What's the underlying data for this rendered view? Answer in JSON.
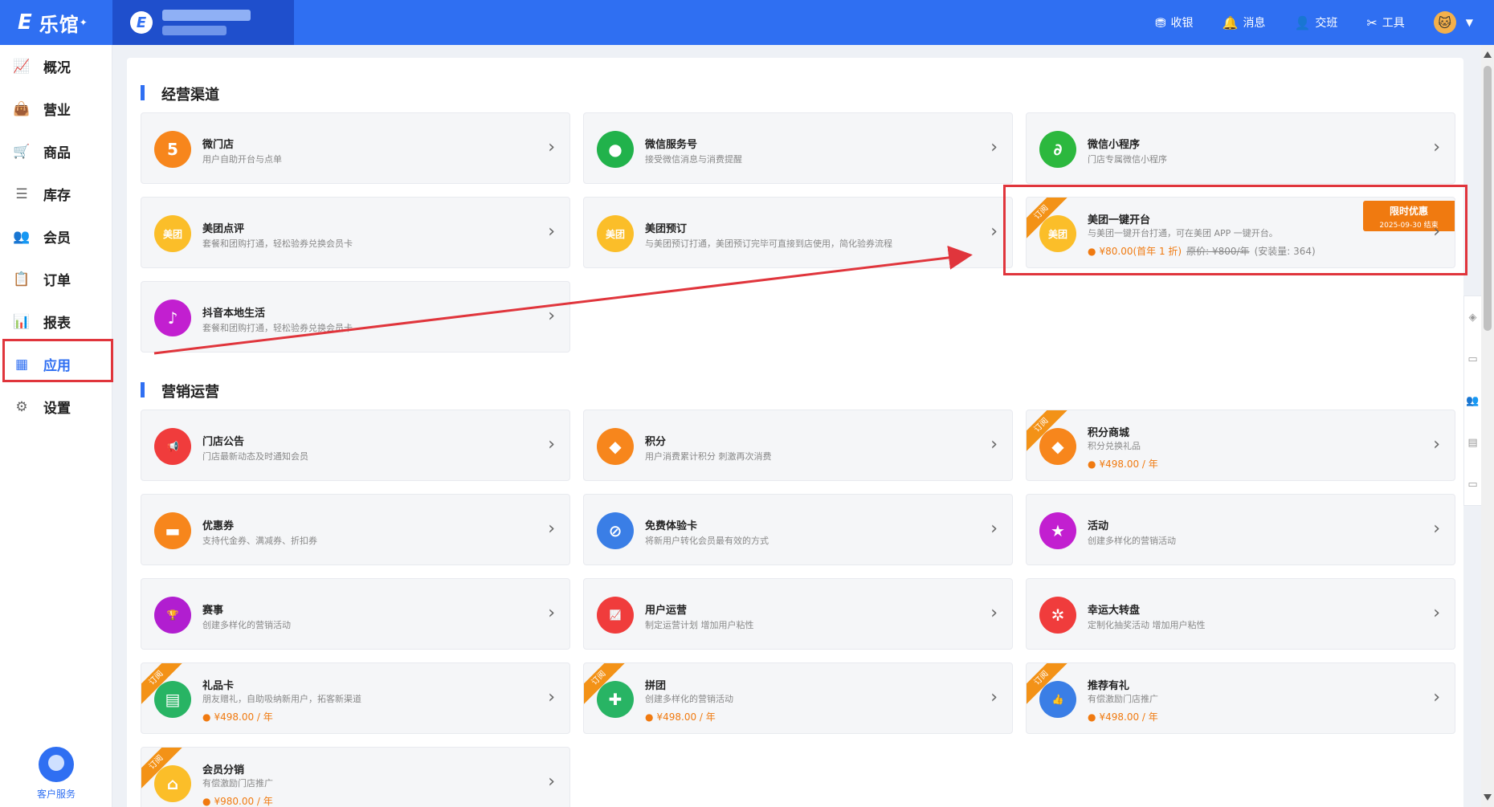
{
  "brand": {
    "name": "乐馆",
    "logo_letter": "E"
  },
  "store": {
    "logo_letter": "E"
  },
  "top_actions": [
    {
      "label": "收银",
      "icon": "cashier-icon",
      "glyph": "⛃"
    },
    {
      "label": "消息",
      "icon": "bell-icon",
      "glyph": "🔔"
    },
    {
      "label": "交班",
      "icon": "handover-icon",
      "glyph": "👤"
    },
    {
      "label": "工具",
      "icon": "tools-icon",
      "glyph": "✂"
    }
  ],
  "sidebar": {
    "items": [
      {
        "label": "概况",
        "glyph": "📈"
      },
      {
        "label": "营业",
        "glyph": "👜"
      },
      {
        "label": "商品",
        "glyph": "🛒"
      },
      {
        "label": "库存",
        "glyph": "☰"
      },
      {
        "label": "会员",
        "glyph": "👥"
      },
      {
        "label": "订单",
        "glyph": "📋"
      },
      {
        "label": "报表",
        "glyph": "📊"
      },
      {
        "label": "应用",
        "glyph": "▦"
      },
      {
        "label": "设置",
        "glyph": "⚙"
      }
    ],
    "active": "应用",
    "customer_service": "客户服务"
  },
  "sections": {
    "channels_title": "经营渠道",
    "marketing_title": "营销运营"
  },
  "channels": [
    {
      "title": "微门店",
      "desc": "用户自助开台与点单",
      "color": "#f7861c",
      "glyph": "5"
    },
    {
      "title": "微信服务号",
      "desc": "接受微信消息与消费提醒",
      "color": "#21b24b",
      "glyph": "●"
    },
    {
      "title": "微信小程序",
      "desc": "门店专属微信小程序",
      "color": "#2cb83e",
      "glyph": "∂"
    },
    {
      "title": "美团点评",
      "desc": "套餐和团购打通，轻松验券兑换会员卡",
      "color": "#fbbe29",
      "glyph": "美团"
    },
    {
      "title": "美团预订",
      "desc": "与美团预订打通，美团预订完毕可直接到店使用，简化验券流程",
      "color": "#fbbe29",
      "glyph": "美团"
    },
    {
      "title": "美团一键开台",
      "desc": "与美团一键开台打通，可在美团 APP 一键开台。",
      "color": "#fbbe29",
      "glyph": "美团",
      "ribbon": "订阅",
      "price": "¥80.00(首年 1 折)",
      "orig_price": "原价: ¥800/年",
      "install_count": "(安装量: 364)",
      "promo_title": "限时优惠",
      "promo_date": "2025-09-30 结束"
    },
    {
      "title": "抖音本地生活",
      "desc": "套餐和团购打通，轻松验券兑换会员卡",
      "color": "#c21fd0",
      "glyph": "♪"
    }
  ],
  "marketing": [
    {
      "title": "门店公告",
      "desc": "门店最新动态及时通知会员",
      "color": "#f03c3c",
      "glyph": "📢"
    },
    {
      "title": "积分",
      "desc": "用户消费累计积分 刺激再次消费",
      "color": "#f7861c",
      "glyph": "◆"
    },
    {
      "title": "积分商城",
      "desc": "积分兑换礼品",
      "color": "#f7861c",
      "glyph": "◆",
      "ribbon": "订阅",
      "price": "¥498.00 / 年"
    },
    {
      "title": "优惠券",
      "desc": "支持代金券、满减券、折扣券",
      "color": "#f7861c",
      "glyph": "▬"
    },
    {
      "title": "免费体验卡",
      "desc": "将新用户转化会员最有效的方式",
      "color": "#3a7ee6",
      "glyph": "⊘"
    },
    {
      "title": "活动",
      "desc": "创建多样化的营销活动",
      "color": "#c21fd0",
      "glyph": "★"
    },
    {
      "title": "赛事",
      "desc": "创建多样化的营销活动",
      "color": "#b11ed0",
      "glyph": "🏆"
    },
    {
      "title": "用户运营",
      "desc": "制定运营计划 增加用户粘性",
      "color": "#f03c3c",
      "glyph": "📈"
    },
    {
      "title": "幸运大转盘",
      "desc": "定制化抽奖活动 增加用户粘性",
      "color": "#f03c3c",
      "glyph": "✲"
    },
    {
      "title": "礼品卡",
      "desc": "朋友赠礼，自助吸纳新用户，拓客新渠道",
      "color": "#28b464",
      "glyph": "▤",
      "ribbon": "订阅",
      "price": "¥498.00 / 年"
    },
    {
      "title": "拼团",
      "desc": "创建多样化的营销活动",
      "color": "#28b464",
      "glyph": "✚",
      "ribbon": "订阅",
      "price": "¥498.00 / 年"
    },
    {
      "title": "推荐有礼",
      "desc": "有偿激励门店推广",
      "color": "#3a7ee6",
      "glyph": "👍",
      "ribbon": "订阅",
      "price": "¥498.00 / 年"
    },
    {
      "title": "会员分销",
      "desc": "有偿激励门店推广",
      "color": "#fbbe29",
      "glyph": "⌂",
      "ribbon": "订阅",
      "price": "¥980.00 / 年"
    }
  ],
  "colors": {
    "primary": "#2f6ff2",
    "highlight": "#e0353c",
    "price": "#f07a10"
  }
}
